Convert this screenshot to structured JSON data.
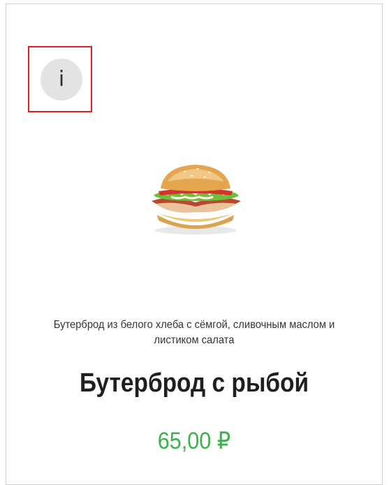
{
  "product": {
    "info_icon": "info-icon",
    "info_glyph": "i",
    "image_icon": "burger-image",
    "description": "Бутерброд из белого хлеба с сёмгой, сливочным маслом и листиком салата",
    "title": "Бутерброд с рыбой",
    "price": "65,00 ₽"
  },
  "colors": {
    "highlight": "#e02020",
    "price": "#3bb24a",
    "info_bg": "#e3e3e3"
  }
}
